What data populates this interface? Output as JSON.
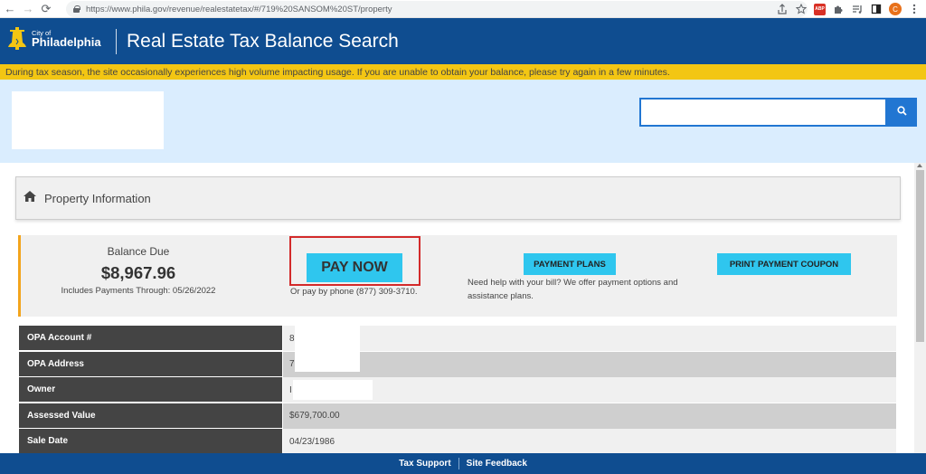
{
  "browser": {
    "url": "https://www.phila.gov/revenue/realestatetax/#/719%20SANSOM%20ST/property",
    "back_icon": "←",
    "forward_icon": "→",
    "reload_icon": "⟳",
    "abp_label": "ABP",
    "profile_initial": "C"
  },
  "header": {
    "logo_city": "City of",
    "logo_name": "Philadelphia",
    "title": "Real Estate Tax Balance Search",
    "brand_color": "#0f4d90"
  },
  "alert": {
    "text": "During tax season, the site occasionally experiences high volume impacting usage. If you are unable to obtain your balance, please try again in a few minutes.",
    "color": "#f3c613"
  },
  "search": {
    "value": "",
    "button_icon": "search-icon"
  },
  "property_panel": {
    "title": "Property Information",
    "icon": "home-icon"
  },
  "balance": {
    "label": "Balance Due",
    "amount": "$8,967.96",
    "payments_through": "Includes Payments Through: 05/26/2022",
    "pay_now_label": "PAY NOW",
    "pay_by_phone": "Or pay by phone (877) 309-3710.",
    "payment_plans_label": "PAYMENT PLANS",
    "payment_plans_help": "Need help with your bill? We offer payment options and assistance plans.",
    "print_coupon_label": "PRINT PAYMENT COUPON",
    "button_color": "#2fc6ee",
    "accent_color": "#f3a41c"
  },
  "property_table": {
    "rows": [
      {
        "label": "OPA Account #",
        "value": "8"
      },
      {
        "label": "OPA Address",
        "value": "7"
      },
      {
        "label": "Owner",
        "value": "I"
      },
      {
        "label": "Assessed Value",
        "value": "$679,700.00"
      },
      {
        "label": "Sale Date",
        "value": "04/23/1986"
      }
    ]
  },
  "footer": {
    "links": [
      "Tax Support",
      "Site Feedback"
    ]
  }
}
